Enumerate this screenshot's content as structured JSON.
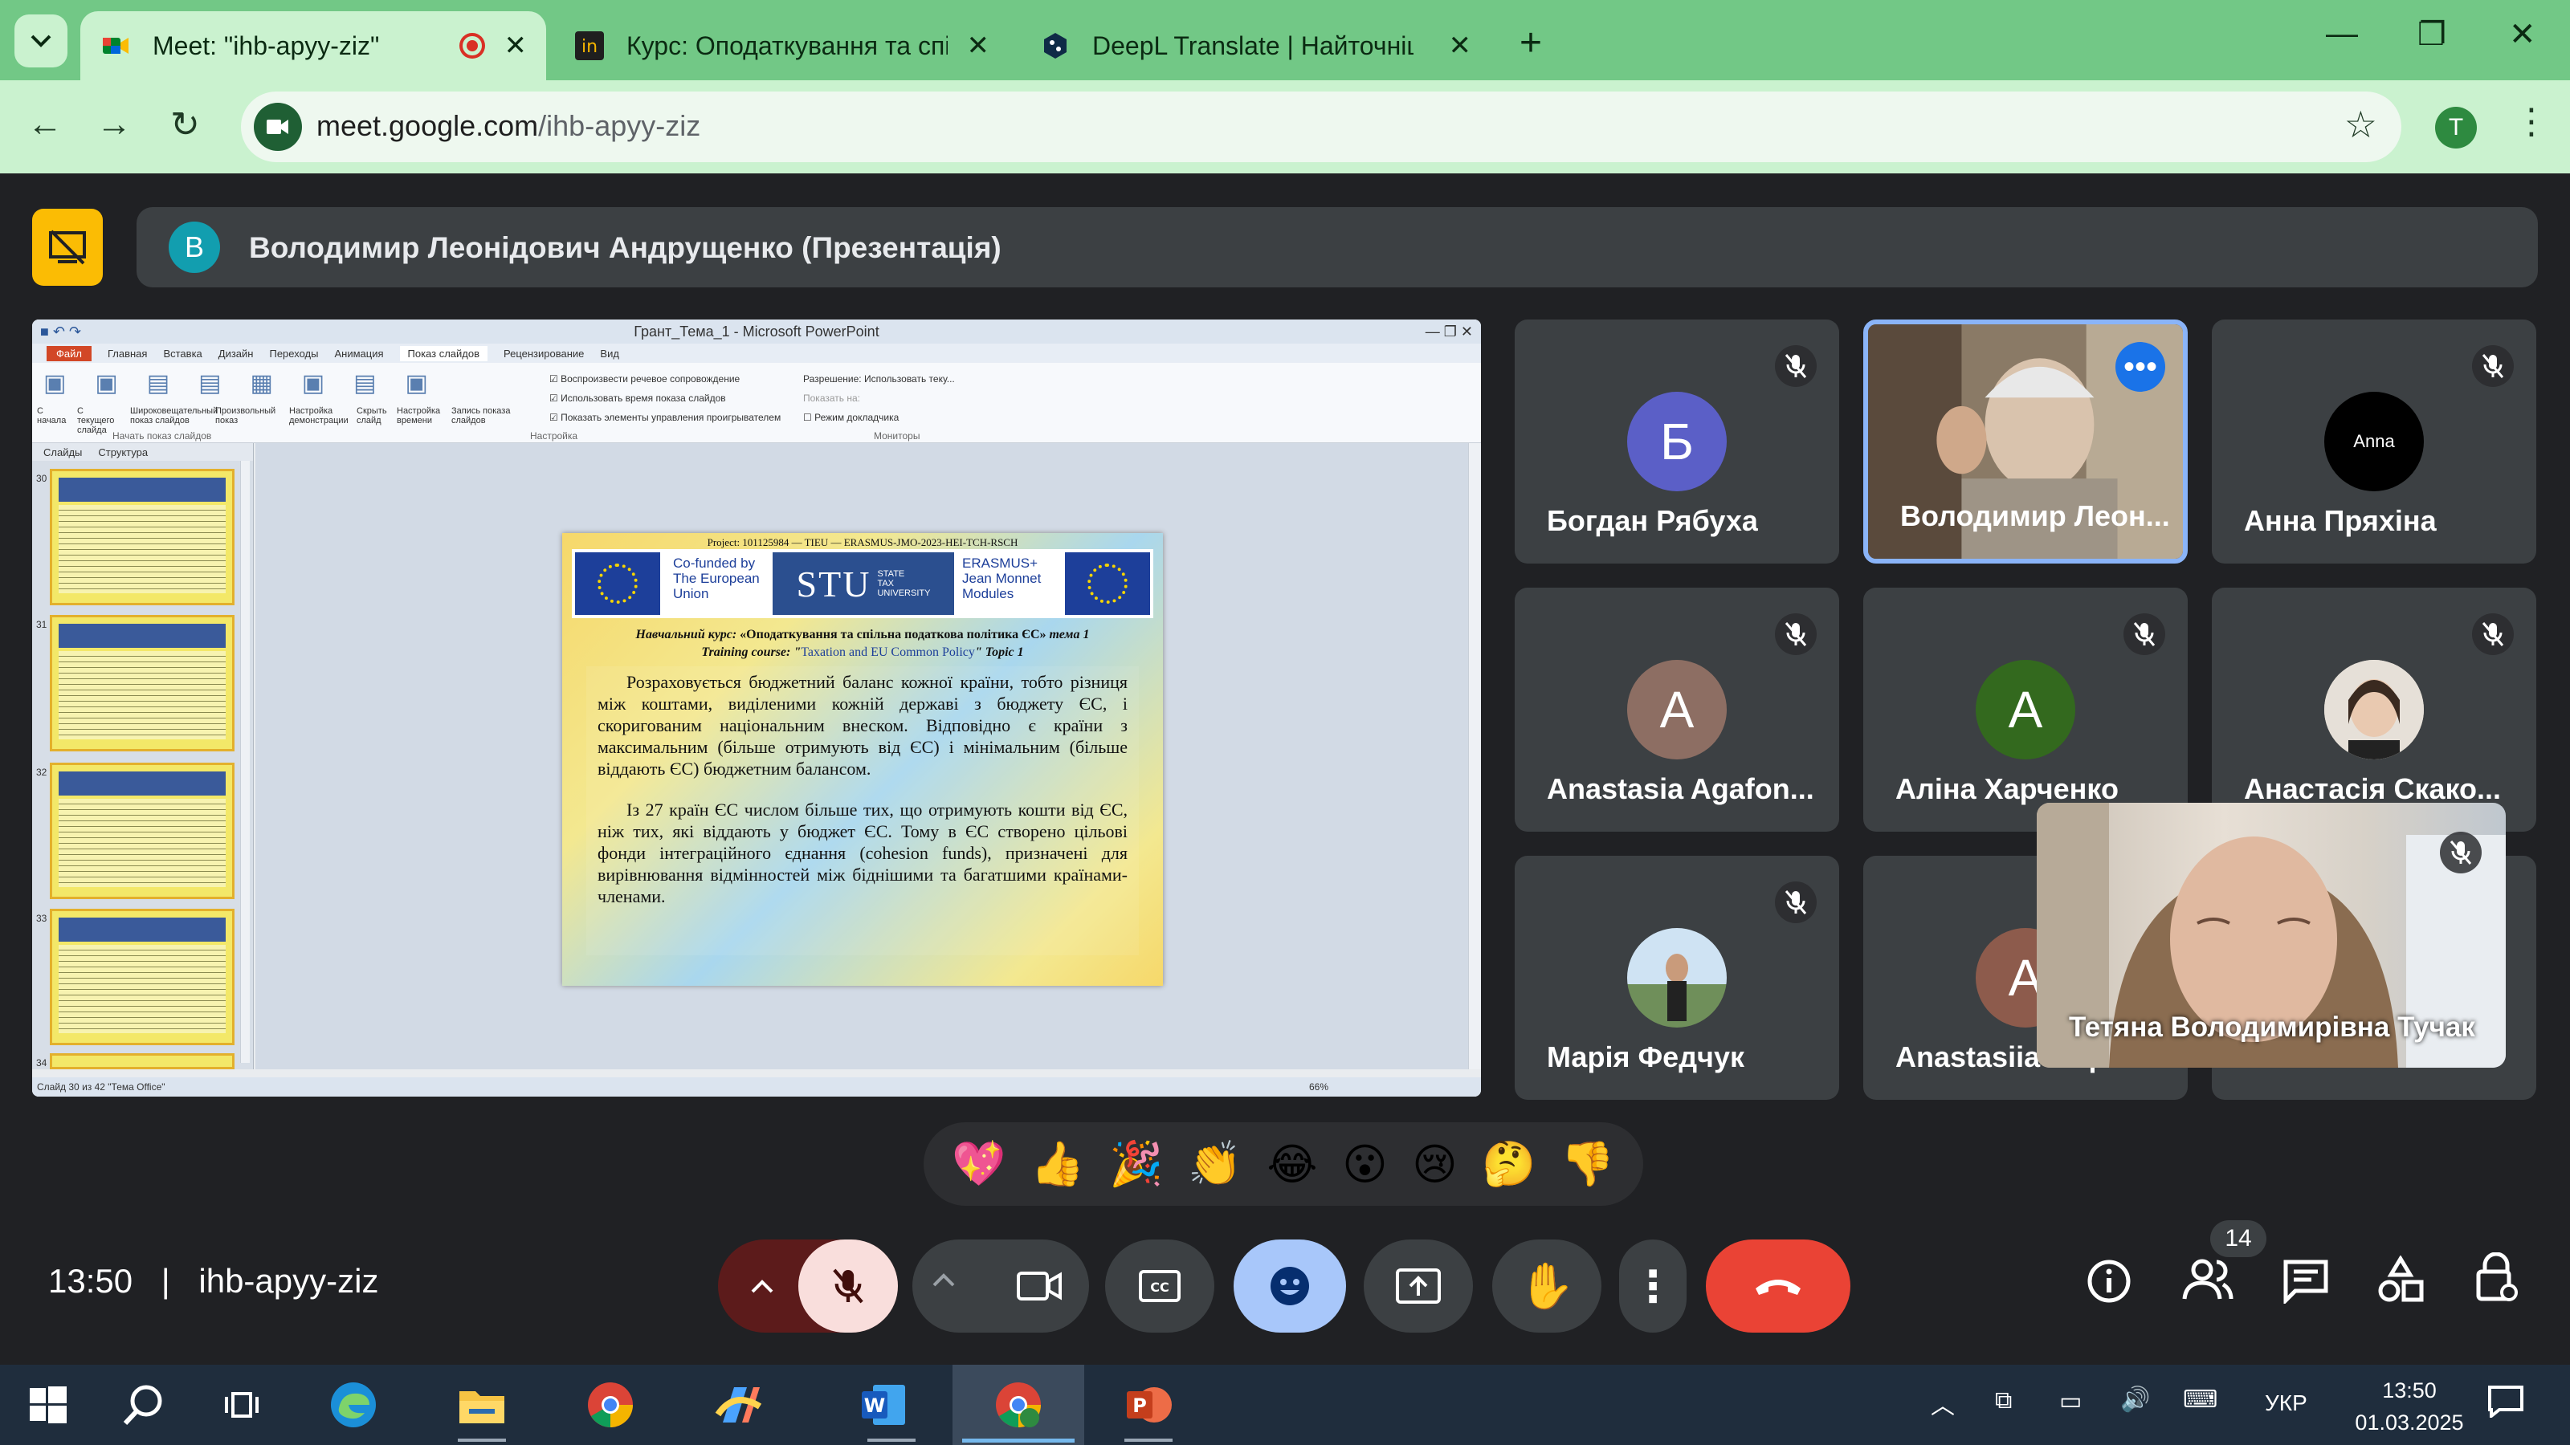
{
  "browser": {
    "tabs": [
      {
        "title": "Meet: \"ihb-apyy-ziz\"",
        "active": true
      },
      {
        "title": "Курс: Оподаткування та спільн",
        "active": false
      },
      {
        "title": "DeepL Translate | Найточніший",
        "active": false
      }
    ],
    "url_host": "meet.google.com",
    "url_path": "/ihb-apyy-ziz",
    "profile_initial": "T",
    "accent": "#72c886"
  },
  "presenter": {
    "avatar_letter": "В",
    "label": "Володимир Леонідович Андрущенко (Презентація)"
  },
  "powerpoint": {
    "window_title": "Грант_Тема_1 - Microsoft PowerPoint",
    "tabs": [
      "Файл",
      "Главная",
      "Вставка",
      "Дизайн",
      "Переходы",
      "Анимация",
      "Показ слайдов",
      "Рецензирование",
      "Вид"
    ],
    "selected_tab": "Показ слайдов",
    "ribbon_buttons": [
      "С начала",
      "С текущего слайда",
      "Широковещательный показ слайдов",
      "Произвольный показ",
      "Настройка демонстрации",
      "Скрыть слайд",
      "Настройка времени",
      "Запись показа слайдов"
    ],
    "checkboxes": [
      "Воспроизвести речевое сопровождение",
      "Использовать время показа слайдов",
      "Показать элементы управления проигрывателем"
    ],
    "monitor_options": [
      "Разрешение:",
      "Использовать теку...",
      "Показать на:",
      "Режим докладчика"
    ],
    "groups": [
      "Начать показ слайдов",
      "Настройка",
      "Мониторы"
    ],
    "pane_tabs": [
      "Слайды",
      "Структура"
    ],
    "slide_numbers": [
      "30",
      "31",
      "32",
      "33",
      "34"
    ],
    "status_text": "Слайд 30 из 42   \"Тема Office\"",
    "zoom": "66%"
  },
  "slide": {
    "project": "Project: 101125984 — TIEU — ERASMUS-JMO-2023-HEI-TCH-RSCH",
    "cofunded": [
      "Co-funded by",
      "The European",
      "Union"
    ],
    "university": "STU",
    "university_sub": [
      "STATE",
      "TAX",
      "UNIVERSITY"
    ],
    "erasmus": [
      "ERASMUS+",
      "Jean Monnet",
      "Modules"
    ],
    "course_ua_prefix": "Навчальний курс: ",
    "course_ua": "«Оподаткування та спільна податкова політика ЄС»",
    "course_ua_suffix": " тема 1",
    "course_en_prefix": "Training course: \"",
    "course_en": "Taxation and EU Common Policy",
    "course_en_suffix": "\" Topic 1",
    "para1": "Розраховується бюджетний баланс кожної країни, тобто різниця між коштами, виділеними кожній державі з бюджету ЄС, і скоригованим національним внеском. Відповідно є країни з максимальним (більше отримують від ЄС) і мінімальним (більше віддають ЄС) бюджетним балансом.",
    "para2": "Із 27 країн ЄС числом більше тих, що отримують кошти від ЄС, ніж тих, які віддають у бюджет ЄС. Тому в ЄС створено цільові фонди інтеграційного єднання (cohesion funds), призначені для вирівнювання відмінностей між біднішими та багатшими країнами-членами."
  },
  "participants": [
    {
      "name": "Богдан Рябуха",
      "letter": "Б",
      "color": "#5b5fc7"
    },
    {
      "name": "Володимир Леон...",
      "letter": "",
      "color": "#3c4043"
    },
    {
      "name": "Анна Пряхіна",
      "letter": "Anna",
      "color": "#000000"
    },
    {
      "name": "Anastasia Agafon...",
      "letter": "A",
      "color": "#8d6e63"
    },
    {
      "name": "Аліна Харченко",
      "letter": "A",
      "color": "#33691e"
    },
    {
      "name": "Анастасія Скако...",
      "letter": "",
      "color": "#3c4043"
    },
    {
      "name": "Марія Федчук",
      "letter": "",
      "color": "#3c4043"
    },
    {
      "name": "Anastasiia Марчен...",
      "letter": "A",
      "color": "#8d5b4c"
    },
    {
      "name": "Тетяна Володимирівна Тучак",
      "letter": "",
      "color": "#3c4043"
    }
  ],
  "reactions": [
    "💖",
    "👍",
    "🎉",
    "👏",
    "😂",
    "😮",
    "😢",
    "🤔",
    "👎"
  ],
  "meeting": {
    "time": "13:50",
    "separator": "|",
    "code": "ihb-apyy-ziz",
    "people_count": "14"
  },
  "taskbar": {
    "lang": "УКР",
    "time": "13:50",
    "date": "01.03.2025"
  }
}
